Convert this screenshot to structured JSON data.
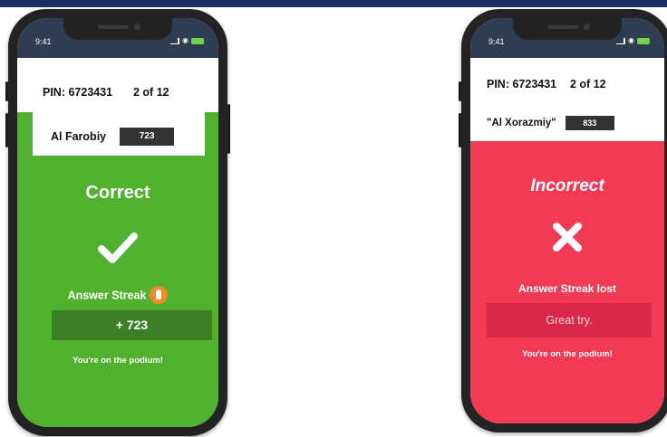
{
  "colors": {
    "correct_bg": "#4fb12d",
    "incorrect_bg": "#f23a55",
    "points_box": "#3d7f26",
    "try_box": "#d9284a",
    "frame": "#232323",
    "top_bar": "#1e2f63"
  },
  "left_phone": {
    "status_time": "9:41",
    "pin": "PIN: 6723431",
    "progress": "2 of 12",
    "player_name": "Al Farobiy",
    "player_score": "723",
    "result": "Correct",
    "result_icon": "checkmark-icon",
    "streak": "Answer Streak",
    "streak_icon": "flame-icon",
    "points": "+ 723",
    "message": "You're on the podium!"
  },
  "right_phone": {
    "status_time": "9:41",
    "pin": "PIN: 6723431",
    "progress": "2 of 12",
    "player_name": "\"Al Xorazmiy\"",
    "player_score": "833",
    "result": "Incorrect",
    "result_icon": "cross-icon",
    "streak": "Answer Streak lost",
    "try_text": "Great try.",
    "message": "You're on the podium!"
  }
}
